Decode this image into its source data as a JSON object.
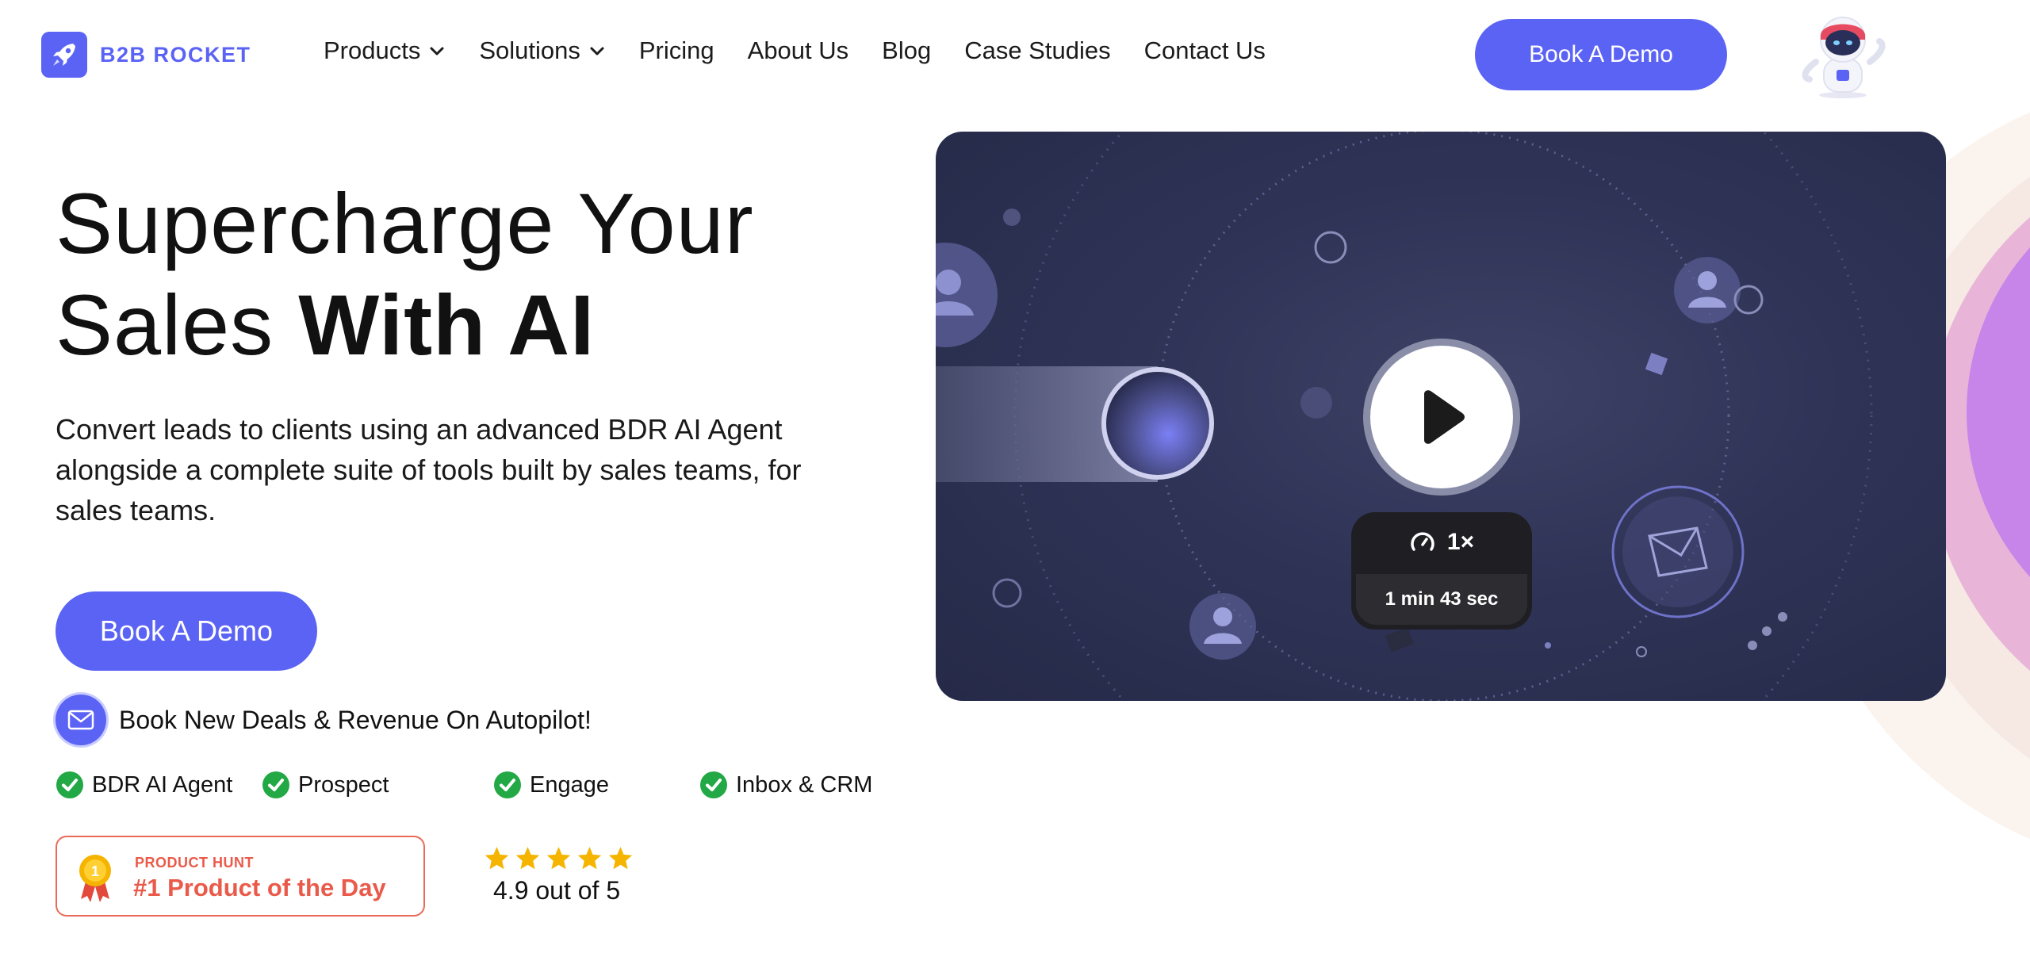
{
  "brand": {
    "name": "B2B ROCKET",
    "accent": "#5b63f5",
    "icon": "rocket-icon"
  },
  "nav": {
    "items": [
      {
        "label": "Products",
        "dropdown": true
      },
      {
        "label": "Solutions",
        "dropdown": true
      },
      {
        "label": "Pricing",
        "dropdown": false
      },
      {
        "label": "About Us",
        "dropdown": false
      },
      {
        "label": "Blog",
        "dropdown": false
      },
      {
        "label": "Case Studies",
        "dropdown": false
      },
      {
        "label": "Contact Us",
        "dropdown": false
      }
    ],
    "cta_label": "Book A Demo",
    "assistant_icon": "robot-assistant-icon"
  },
  "hero": {
    "title_line1": "Supercharge Your",
    "title_line2_light": "Sales",
    "title_line2_bold": "With AI",
    "subtitle": "Convert leads to clients using an advanced BDR AI Agent alongside a complete suite of tools built by sales teams, for sales teams.",
    "cta_label": "Book A Demo",
    "autopilot_text": "Book New Deals & Revenue On Autopilot!",
    "features": [
      "BDR AI Agent",
      "Prospect",
      "Engage",
      "Inbox & CRM"
    ]
  },
  "badges": {
    "product_hunt_label": "PRODUCT HUNT",
    "product_hunt_title": "#1 Product of the Day",
    "product_hunt_rank": "1",
    "rating_stars": 5,
    "rating_text": "4.9 out of 5"
  },
  "video": {
    "speed": "1×",
    "duration": "1 min 43 sec",
    "play_icon": "play-icon",
    "speed_icon": "speedometer-icon"
  },
  "colors": {
    "accent": "#5b63f5",
    "check_green": "#22a845",
    "product_hunt_red": "#ea5a4a",
    "star_gold": "#f5b400"
  }
}
